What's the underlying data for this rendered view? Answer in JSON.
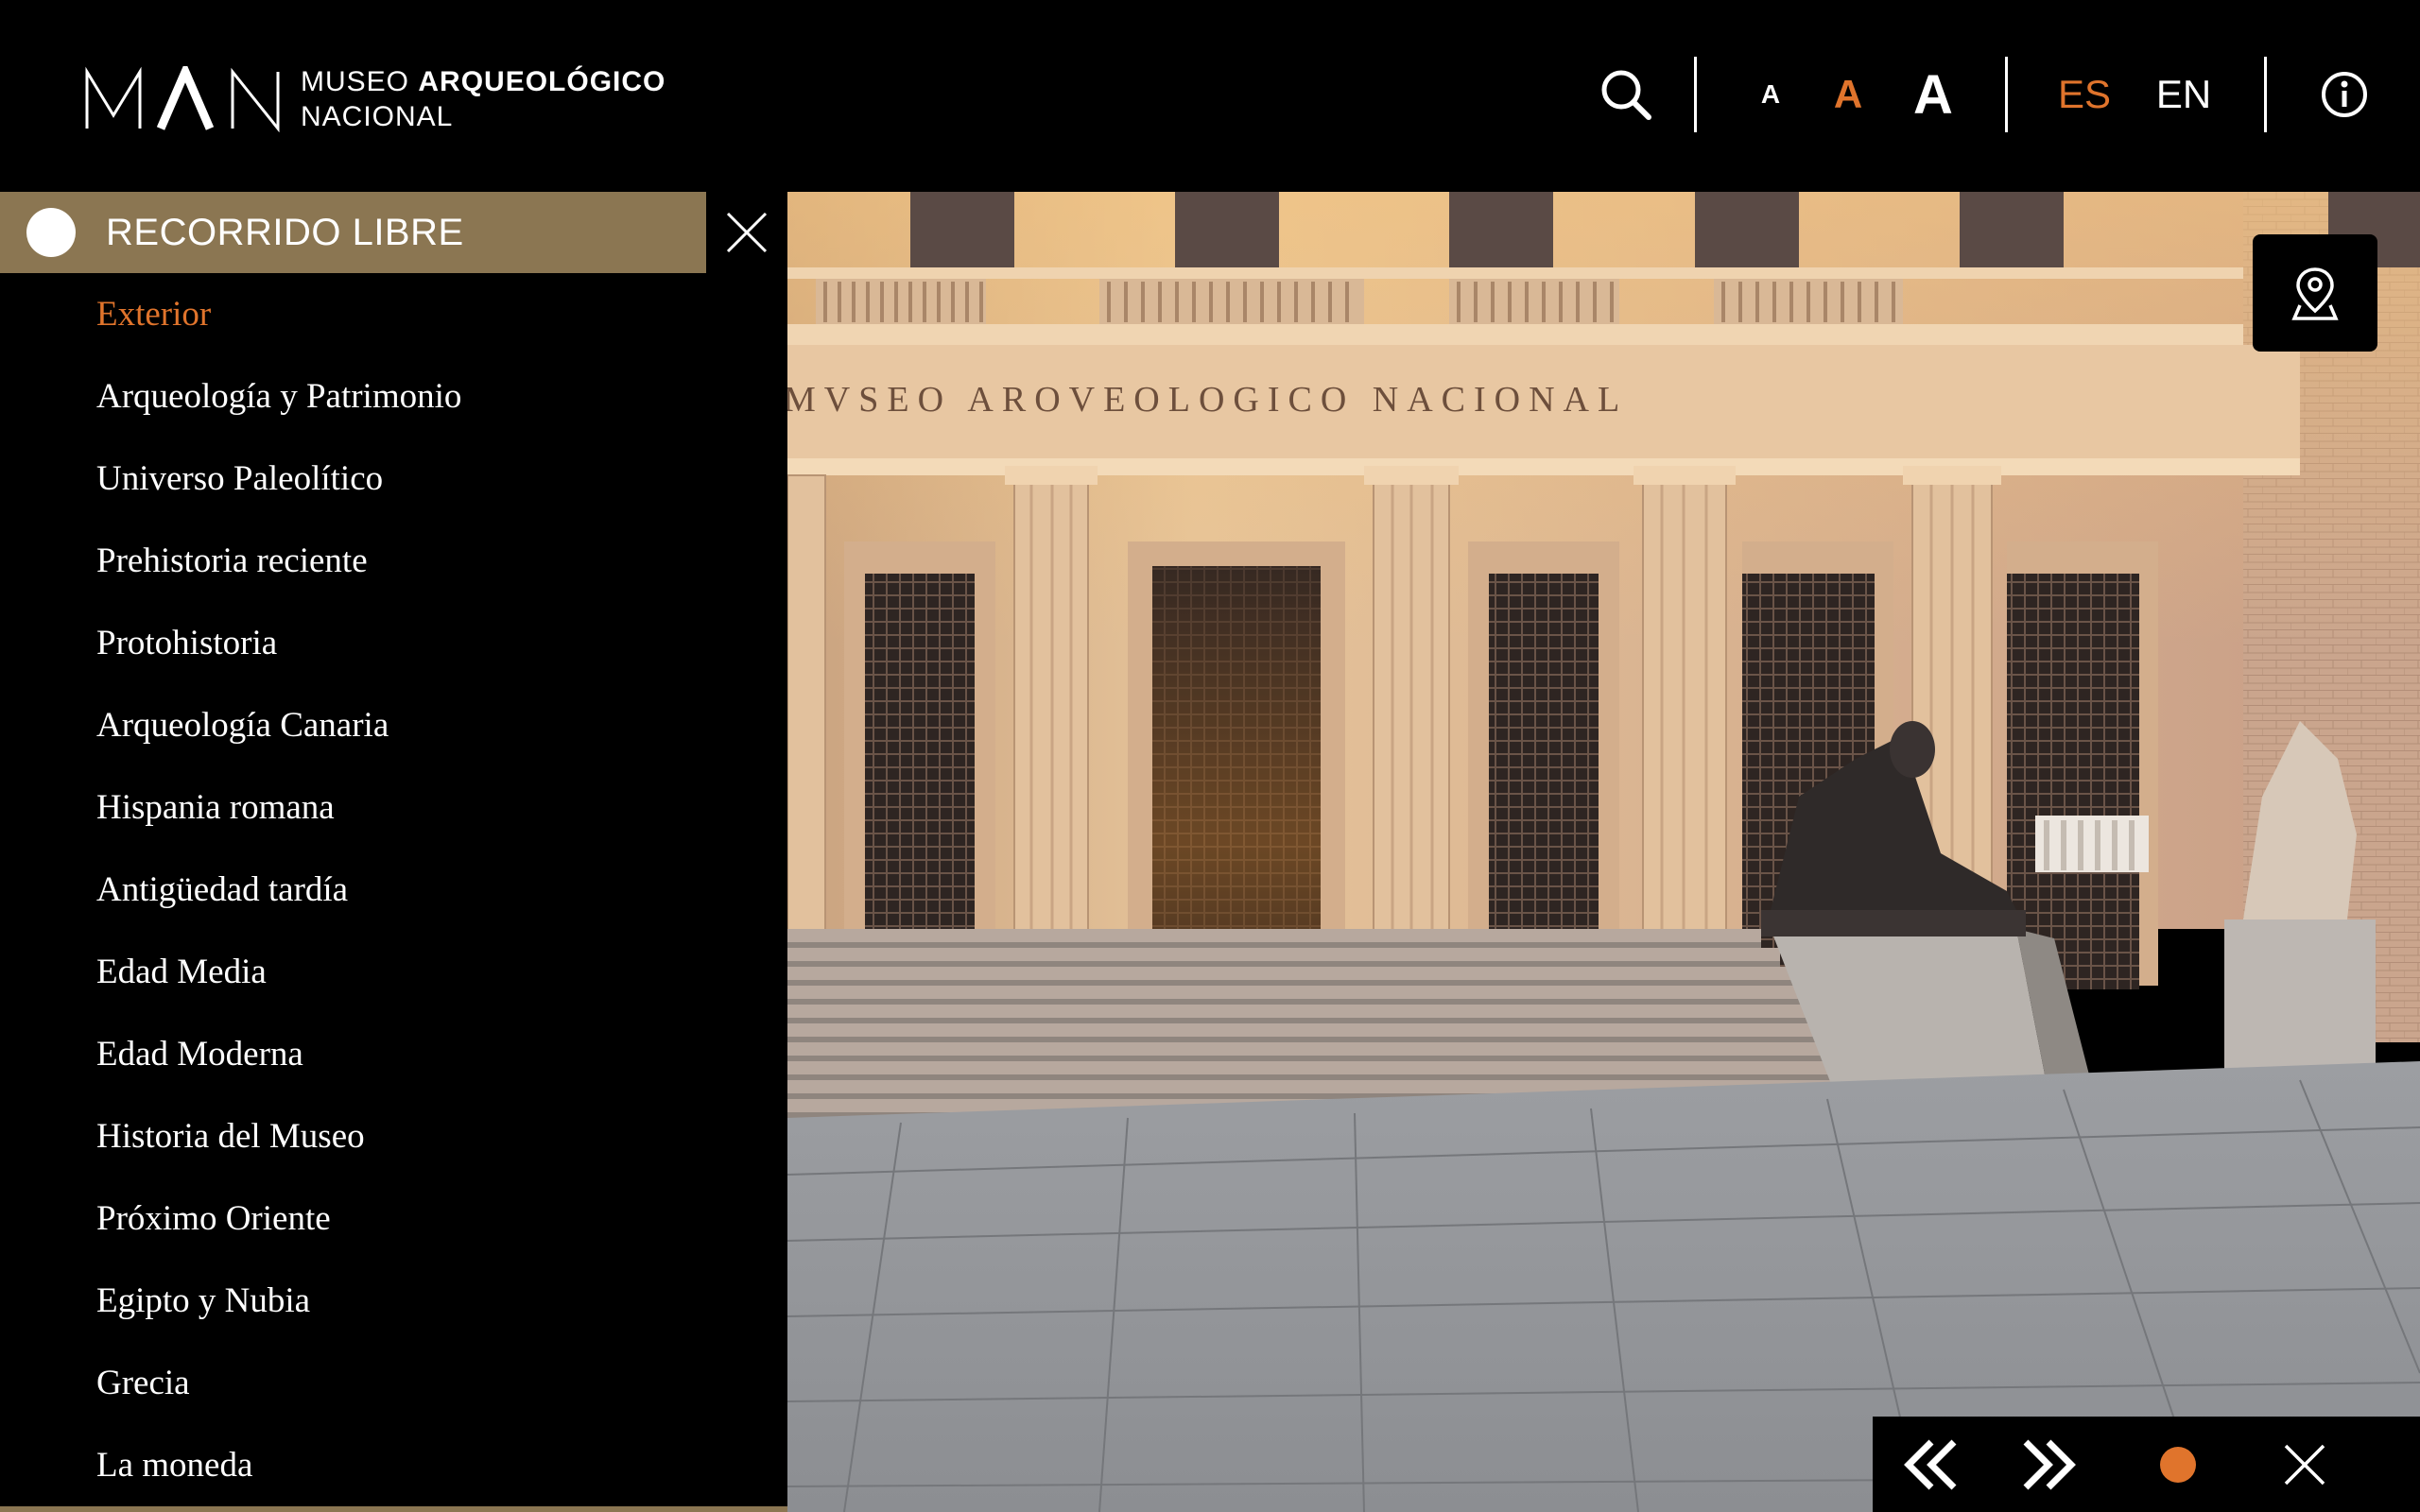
{
  "header": {
    "logo_mark": "MAN",
    "logo_line1_plain": "MUSEO ",
    "logo_line1_bold": "ARQUEOLÓGICO",
    "logo_line2": "NACIONAL",
    "font_small": "A",
    "font_medium": "A",
    "font_large": "A",
    "lang_es": "ES",
    "lang_en": "EN",
    "icons": [
      "search-icon",
      "info-icon"
    ]
  },
  "sidebar": {
    "tour_label": "RECORRIDO LIBRE",
    "items": [
      {
        "label": "Exterior",
        "active": true
      },
      {
        "label": "Arqueología y Patrimonio"
      },
      {
        "label": "Universo Paleolítico"
      },
      {
        "label": "Prehistoria reciente"
      },
      {
        "label": "Protohistoria"
      },
      {
        "label": "Arqueología Canaria"
      },
      {
        "label": "Hispania romana"
      },
      {
        "label": "Antigüedad tardía"
      },
      {
        "label": "Edad Media"
      },
      {
        "label": "Edad Moderna"
      },
      {
        "label": "Historia del Museo"
      },
      {
        "label": "Próximo Oriente"
      },
      {
        "label": "Egipto y Nubia"
      },
      {
        "label": "Grecia"
      },
      {
        "label": "La moneda"
      }
    ]
  },
  "panorama": {
    "facade_inscription": "MVSEO AROVEOLOGICO NACIONAL"
  },
  "nav_panel": {
    "icons": [
      "double-chevron-left-icon",
      "double-chevron-right-icon",
      "record-dot-icon",
      "close-icon"
    ]
  },
  "colors": {
    "accent": "#e0742c",
    "tour_bar": "#8b7652",
    "background": "#000000"
  }
}
